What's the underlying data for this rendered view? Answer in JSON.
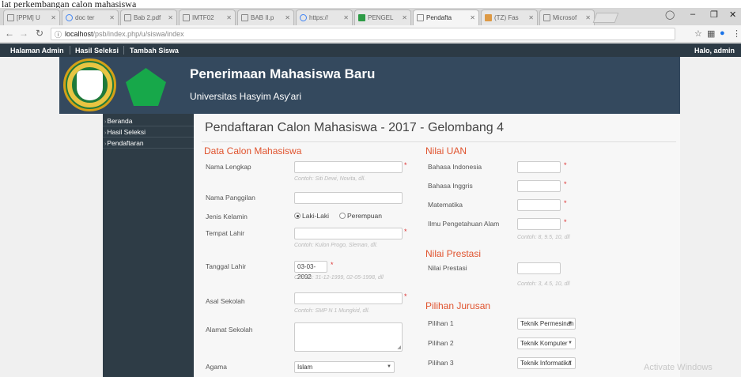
{
  "caption": "lat perkembangan calon mahasiswa",
  "browser": {
    "tabs": [
      {
        "label": "[PPM] U",
        "icon": "page-icon"
      },
      {
        "label": "doc ter",
        "icon": "google-icon"
      },
      {
        "label": "Bab 2.pdf",
        "icon": "page-icon"
      },
      {
        "label": "IMTF02",
        "icon": "page-icon"
      },
      {
        "label": "BAB II.p",
        "icon": "page-icon"
      },
      {
        "label": "https://",
        "icon": "google-icon"
      },
      {
        "label": "PENGEL",
        "icon": "sheet-icon"
      },
      {
        "label": "Pendafta",
        "icon": "page-icon",
        "active": true
      },
      {
        "label": "(TZ) Fas",
        "icon": "facebook-icon"
      },
      {
        "label": "Microsof",
        "icon": "page-icon"
      }
    ],
    "url_host": "localhost",
    "url_path": "/psb/index.php/u/siswa/index",
    "window_buttons": [
      "–",
      "❐",
      "✕"
    ]
  },
  "adminbar": {
    "items": [
      "Halaman Admin",
      "Hasil Seleksi",
      "Tambah Siswa"
    ],
    "greeting": "Halo, admin"
  },
  "banner": {
    "title": "Penerimaan Mahasiswa Baru",
    "subtitle": "Universitas Hasyim Asy'ari"
  },
  "sidebar": {
    "items": [
      "Beranda",
      "Hasil Seleksi",
      "Pendaftaran"
    ]
  },
  "main": {
    "title": "Pendaftaran Calon Mahasiswa - 2017 - Gelombang 4",
    "left": {
      "section": "Data Calon Mahasiswa",
      "nama_lengkap": {
        "label": "Nama Lengkap",
        "hint": "Contoh: Siti Dewi, Novita, dll."
      },
      "nama_panggilan": {
        "label": "Nama Panggilan"
      },
      "jenis_kelamin": {
        "label": "Jenis Kelamin",
        "options": [
          "Laki-Laki",
          "Perempuan"
        ],
        "selected": "Laki-Laki"
      },
      "tempat_lahir": {
        "label": "Tempat Lahir",
        "hint": "Contoh: Kulon Progo, Sleman, dll."
      },
      "tanggal_lahir": {
        "label": "Tanggal Lahir",
        "value": "03-03-2002",
        "hint": "Contoh: 31-12-1999, 02-05-1998, dll"
      },
      "asal_sekolah": {
        "label": "Asal Sekolah",
        "hint": "Contoh: SMP N 1 Mungkid, dll."
      },
      "alamat_sekolah": {
        "label": "Alamat Sekolah"
      },
      "agama": {
        "label": "Agama",
        "value": "Islam"
      }
    },
    "right": {
      "uan_section": "Nilai UAN",
      "uan": [
        {
          "label": "Bahasa Indonesia"
        },
        {
          "label": "Bahasa Inggris"
        },
        {
          "label": "Matematika"
        },
        {
          "label": "Ilmu Pengetahuan Alam"
        }
      ],
      "uan_hint": "Contoh: 8, 9.5, 10, dll",
      "prestasi_section": "Nilai Prestasi",
      "prestasi_label": "Nilai Prestasi",
      "prestasi_hint": "Contoh: 3, 4.5, 10, dll",
      "jurusan_section": "Pilihan Jurusan",
      "jurusan": [
        {
          "label": "Pilihan 1",
          "value": "Teknik Permesinan"
        },
        {
          "label": "Pilihan 2",
          "value": "Teknik Komputer Jarir"
        },
        {
          "label": "Pilihan 3",
          "value": "Teknik Informatika"
        }
      ]
    }
  },
  "watermark": "Activate Windows"
}
